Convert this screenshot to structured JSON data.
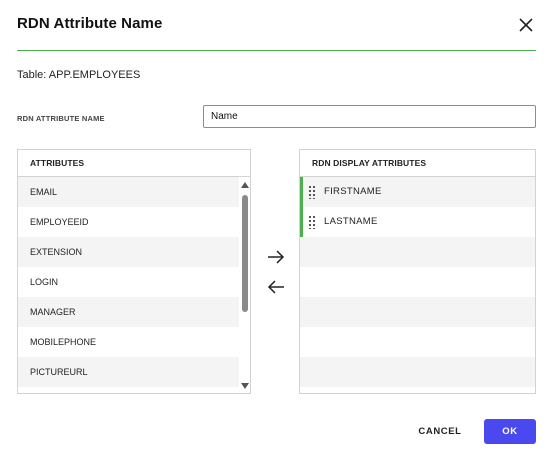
{
  "dialog": {
    "title": "RDN Attribute Name",
    "table_line": "Table: APP.EMPLOYEES"
  },
  "rdn_field": {
    "label": "RDN ATTRIBUTE NAME",
    "value": "Name"
  },
  "attributes_panel": {
    "header": "ATTRIBUTES",
    "items": [
      "EMAIL",
      "EMPLOYEEID",
      "EXTENSION",
      "LOGIN",
      "MANAGER",
      "MOBILEPHONE",
      "PICTUREURL"
    ]
  },
  "display_panel": {
    "header": "RDN DISPLAY ATTRIBUTES",
    "items": [
      "FIRSTNAME",
      "LASTNAME"
    ]
  },
  "footer": {
    "cancel_label": "CANCEL",
    "ok_label": "OK"
  },
  "colors": {
    "accent_green": "#4caf50",
    "primary_button": "#4a49f0"
  },
  "icons": {
    "close": "close-icon",
    "move_right": "arrow-right-icon",
    "move_left": "arrow-left-icon",
    "drag": "drag-handle-icon"
  }
}
